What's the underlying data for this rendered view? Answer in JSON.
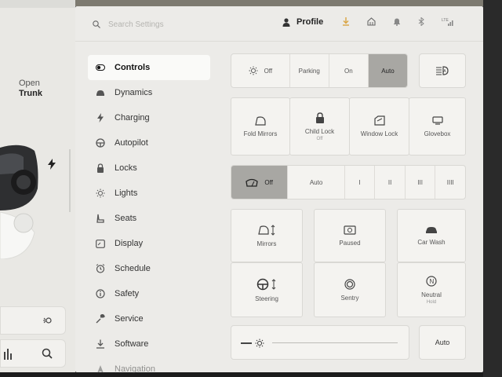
{
  "car": {
    "trunk_line1": "Open",
    "trunk_line2": "Trunk"
  },
  "header": {
    "search_placeholder": "Search Settings",
    "profile_label": "Profile",
    "accent_color": "#d9a441",
    "status_icons": [
      "download-icon",
      "home-icon",
      "bell-icon",
      "bluetooth-icon",
      "signal-icon"
    ]
  },
  "nav": {
    "items": [
      {
        "label": "Controls",
        "icon": "toggle-icon",
        "active": true
      },
      {
        "label": "Dynamics",
        "icon": "car-icon"
      },
      {
        "label": "Charging",
        "icon": "bolt-icon"
      },
      {
        "label": "Autopilot",
        "icon": "steering-wheel-icon"
      },
      {
        "label": "Locks",
        "icon": "lock-icon"
      },
      {
        "label": "Lights",
        "icon": "sun-icon"
      },
      {
        "label": "Seats",
        "icon": "seat-icon"
      },
      {
        "label": "Display",
        "icon": "display-icon"
      },
      {
        "label": "Schedule",
        "icon": "alarm-icon"
      },
      {
        "label": "Safety",
        "icon": "info-icon"
      },
      {
        "label": "Service",
        "icon": "wrench-icon"
      },
      {
        "label": "Software",
        "icon": "download-icon"
      },
      {
        "label": "Navigation",
        "icon": "navigation-icon"
      }
    ]
  },
  "controls": {
    "headlights": {
      "options": [
        "Off",
        "Parking",
        "On",
        "Auto"
      ],
      "selected": "Auto"
    },
    "quick": [
      {
        "label": "Fold Mirrors",
        "sub": ""
      },
      {
        "label": "Child Lock",
        "sub": "Off"
      },
      {
        "label": "Window Lock",
        "sub": ""
      },
      {
        "label": "Glovebox",
        "sub": ""
      }
    ],
    "wipers": {
      "options": [
        "Off",
        "Auto",
        "I",
        "II",
        "III",
        "IIII"
      ],
      "selected": "Off"
    },
    "grid": [
      {
        "label": "Mirrors",
        "sub": ""
      },
      {
        "label": "Paused",
        "sub": ""
      },
      {
        "label": "Car Wash",
        "sub": ""
      },
      {
        "label": "Steering",
        "sub": ""
      },
      {
        "label": "Sentry",
        "sub": ""
      },
      {
        "label": "Neutral",
        "sub": "Hold"
      }
    ],
    "brightness": {
      "auto_label": "Auto"
    }
  }
}
